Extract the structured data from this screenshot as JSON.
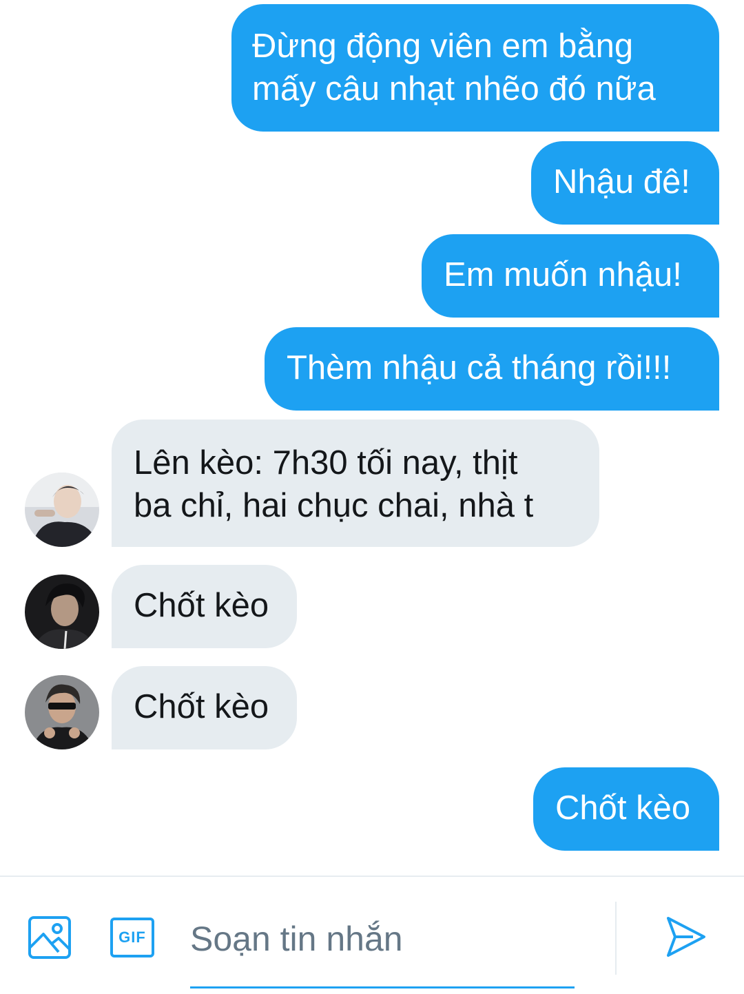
{
  "messages": [
    {
      "direction": "out",
      "text": "Đừng động viên em bằng\nmấy câu nhạt nhẽo đó nữa"
    },
    {
      "direction": "out",
      "text": "Nhậu đê!"
    },
    {
      "direction": "out",
      "text": "Em muốn nhậu!"
    },
    {
      "direction": "out",
      "text": "Thèm nhậu cả tháng rồi!!!"
    },
    {
      "direction": "in",
      "text": "Lên kèo: 7h30 tối nay, thịt\nba chỉ, hai chục chai, nhà t"
    },
    {
      "direction": "in",
      "text": "Chốt kèo"
    },
    {
      "direction": "in",
      "text": "Chốt kèo"
    },
    {
      "direction": "out",
      "text": "Chốt kèo"
    }
  ],
  "composer": {
    "placeholder": "Soạn tin nhắn",
    "gif_label": "GIF",
    "image_icon": "image-icon",
    "gif_icon": "gif-icon",
    "send_icon": "send-icon"
  },
  "colors": {
    "accent": "#1da1f2",
    "incoming_bubble": "#e6ecf0",
    "text_dark": "#14171a",
    "placeholder": "#657786"
  }
}
